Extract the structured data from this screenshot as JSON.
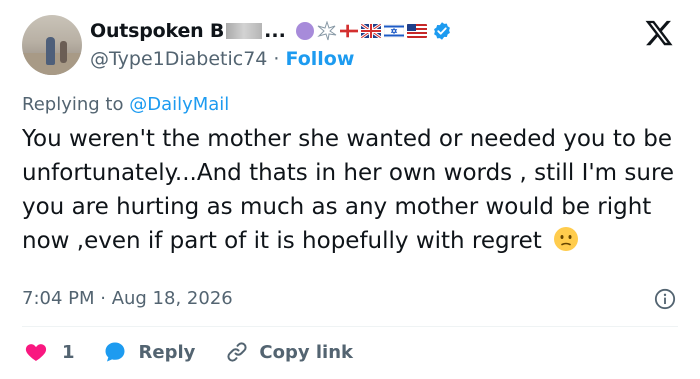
{
  "user": {
    "display_name": "Outspoken B",
    "ellipsis": "...",
    "handle": "@Type1Diabetic74",
    "separator": " · ",
    "follow_label": "Follow"
  },
  "reply_context": {
    "prefix": "Replying to ",
    "mention": "@DailyMail"
  },
  "tweet": {
    "text": "You weren't the mother she wanted or needed you to be unfortunately...And thats in her own words , still I'm sure you are hurting as much as any mother would be right now ,even if part of it is hopefully with regret"
  },
  "meta": {
    "timestamp": "7:04 PM · Aug 18, 2026"
  },
  "actions": {
    "like_count": "1",
    "reply_label": "Reply",
    "copy_label": "Copy link"
  },
  "colors": {
    "accent": "#1d9bf0",
    "like": "#f91880",
    "muted": "#536471",
    "text": "#0f1419"
  },
  "icons": [
    "x-logo-icon",
    "verified-badge-icon",
    "heart-icon",
    "reply-bubble-icon",
    "link-icon",
    "info-icon",
    "slightly-frowning-face-emoji"
  ]
}
